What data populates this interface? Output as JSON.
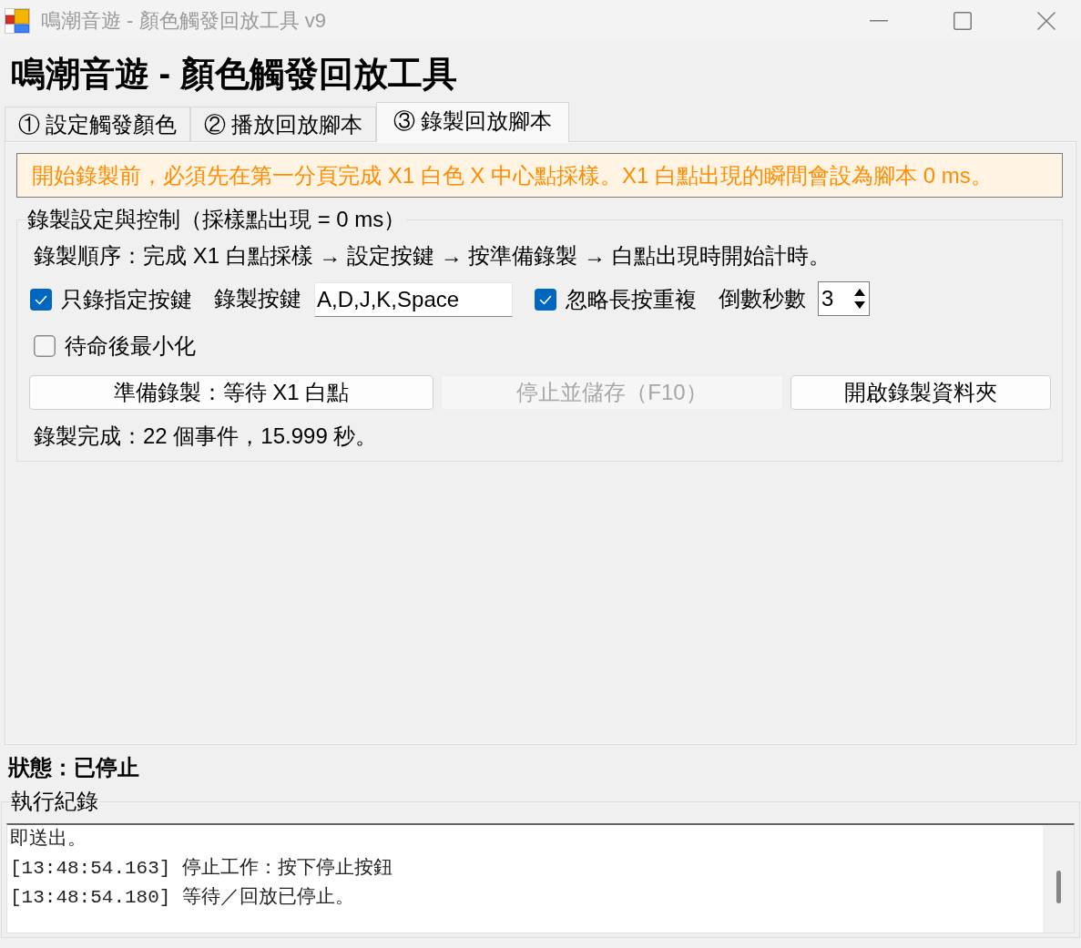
{
  "window": {
    "title": "鳴潮音遊 - 顏色觸發回放工具 v9"
  },
  "heading": "鳴潮音遊 - 顏色觸發回放工具",
  "tabs": [
    {
      "label": "① 設定觸發顏色",
      "selected": false
    },
    {
      "label": "② 播放回放腳本",
      "selected": false
    },
    {
      "label": "③ 錄製回放腳本",
      "selected": true
    }
  ],
  "notice": "開始錄製前，必須先在第一分頁完成 X1 白色 X 中心點採樣。X1 白點出現的瞬間會設為腳本 0 ms。",
  "record_group": {
    "title": "錄製設定與控制（採樣點出現 = 0 ms）",
    "instruction": "錄製順序：完成 X1 白點採樣 → 設定按鍵 → 按準備錄製 → 白點出現時開始計時。",
    "controls": [
      {
        "kind": "checkbox",
        "label": "只錄指定按鍵",
        "checked": true
      },
      {
        "kind": "text_field",
        "label": "錄製按鍵",
        "value": "A,D,J,K,Space"
      },
      {
        "kind": "checkbox",
        "label": "忽略長按重複",
        "checked": true
      },
      {
        "kind": "spinner",
        "label": "倒數秒數",
        "value": "3"
      }
    ],
    "minimize_option": {
      "label": "待命後最小化",
      "checked": false
    },
    "buttons": [
      {
        "label": "準備錄製：等待 X1 白點",
        "disabled": false
      },
      {
        "label": "停止並儲存（F10）",
        "disabled": true
      },
      {
        "label": "開啟錄製資料夾",
        "disabled": false
      }
    ],
    "result": "錄製完成：22 個事件，15.999 秒。"
  },
  "status": "狀態：已停止",
  "log": {
    "title": "執行紀錄",
    "lines": [
      "即送出。",
      "[13:48:54.163] 停止工作：按下停止按鈕",
      "[13:48:54.180] 等待／回放已停止。"
    ]
  }
}
